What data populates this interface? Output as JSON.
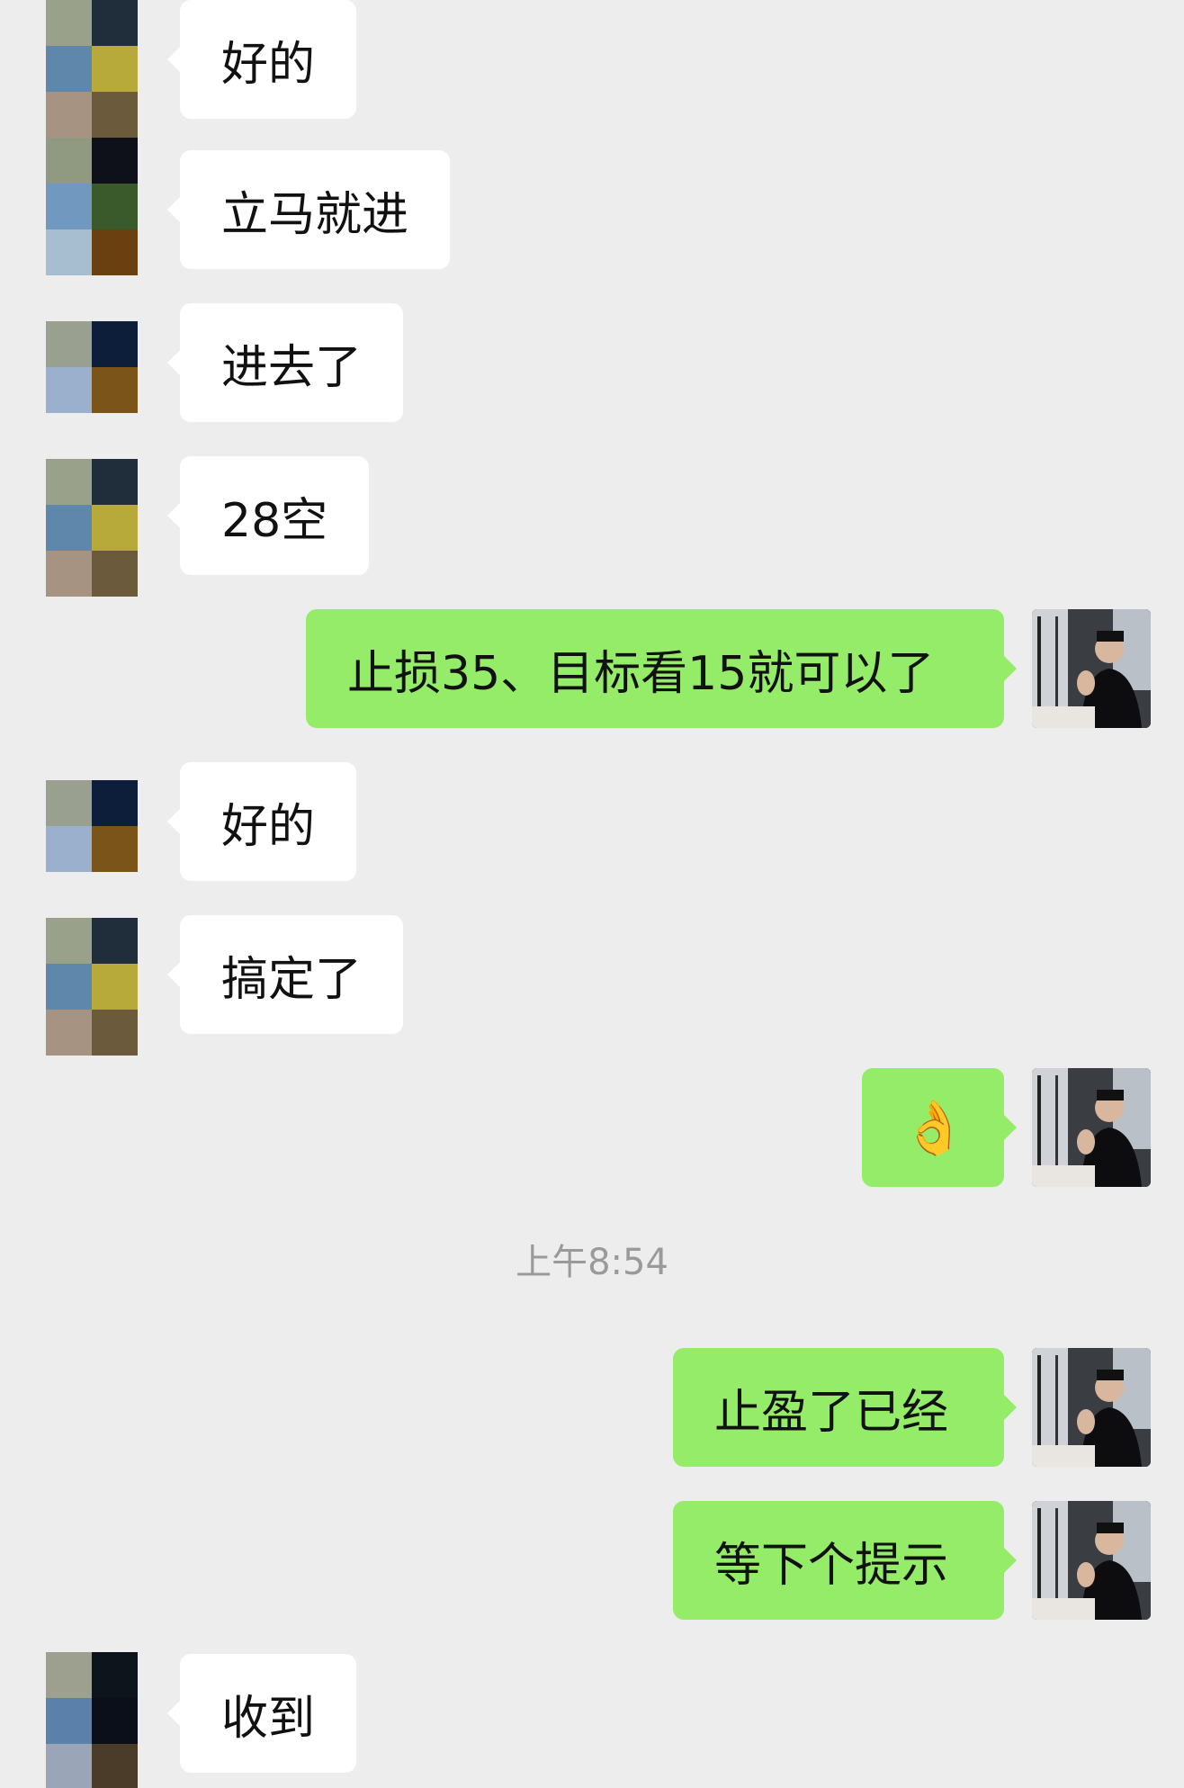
{
  "messages": [
    {
      "side": "left",
      "text": "好的"
    },
    {
      "side": "left",
      "text": "立马就进"
    },
    {
      "side": "left",
      "text": "进去了"
    },
    {
      "side": "left",
      "text": "28空"
    },
    {
      "side": "right",
      "text": "止损35、目标看15就可以了"
    },
    {
      "side": "left",
      "text": "好的"
    },
    {
      "side": "left",
      "text": "搞定了"
    },
    {
      "side": "right",
      "text": "👌"
    },
    {
      "side": "right",
      "text": "止盈了已经"
    },
    {
      "side": "right",
      "text": "等下个提示"
    },
    {
      "side": "left",
      "text": "收到"
    }
  ],
  "timestamp": "上午8:54",
  "colors": {
    "background": "#ededed",
    "incoming_bubble": "#ffffff",
    "outgoing_bubble": "#95ec69",
    "timestamp_text": "#9a9a9a"
  },
  "avatars": {
    "contact_mosaic_a": [
      "#9aa18a",
      "#1f2e3a",
      "#5f86ab",
      "#b8aa3a",
      "#a79381",
      "#6b5a3b"
    ],
    "contact_mosaic_b": [
      "#8f9a80",
      "#0e1119",
      "#7198bf",
      "#3b5a2c",
      "#a7bdd0",
      "#6a4010"
    ],
    "contact_mosaic_c": [
      "#9aa090",
      "#0d1e3a",
      "#9bb0cc",
      "#7a5418"
    ],
    "contact_mosaic_d": [
      "#9ea08f",
      "#0e141b",
      "#5b80aa",
      "#0a0f1a",
      "#9aa6b8",
      "#4a3c28"
    ],
    "self_icon": "person-photo-icon"
  }
}
